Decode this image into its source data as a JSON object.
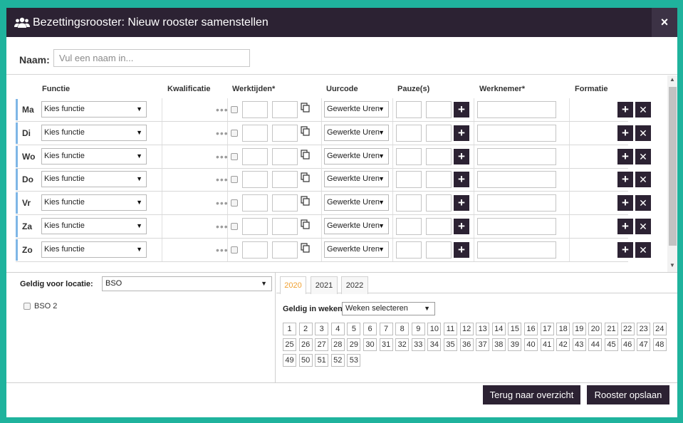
{
  "dialog": {
    "title": "Bezettingsrooster: Nieuw rooster samenstellen",
    "close_label": "×",
    "title_icon": "users-icon"
  },
  "name": {
    "label": "Naam:",
    "placeholder": "Vul een naam in...",
    "value": ""
  },
  "columns": {
    "functie": "Functie",
    "kwalificatie": "Kwalificatie",
    "werktijden": "Werktijden*",
    "uurcode": "Uurcode",
    "pauze": "Pauze(s)",
    "werknemer": "Werknemer*",
    "formatie": "Formatie"
  },
  "rows": [
    {
      "day": "Ma",
      "functie": "Kies functie",
      "uurcode": "Gewerkte Uren"
    },
    {
      "day": "Di",
      "functie": "Kies functie",
      "uurcode": "Gewerkte Uren"
    },
    {
      "day": "Wo",
      "functie": "Kies functie",
      "uurcode": "Gewerkte Uren"
    },
    {
      "day": "Do",
      "functie": "Kies functie",
      "uurcode": "Gewerkte Uren"
    },
    {
      "day": "Vr",
      "functie": "Kies functie",
      "uurcode": "Gewerkte Uren"
    },
    {
      "day": "Za",
      "functie": "Kies functie",
      "uurcode": "Gewerkte Uren"
    },
    {
      "day": "Zo",
      "functie": "Kies functie",
      "uurcode": "Gewerkte Uren"
    }
  ],
  "icons": {
    "dots": "•••",
    "plus": "+",
    "remove": "✕",
    "caret": "▼"
  },
  "location": {
    "label": "Geldig voor locatie:",
    "selected": "BSO",
    "options": [
      "BSO 2"
    ]
  },
  "weeks": {
    "tabs": [
      "2020",
      "2021",
      "2022"
    ],
    "active_tab": "2020",
    "label": "Geldig in weken:",
    "select": "Weken selecteren",
    "numbers": [
      "1",
      "2",
      "3",
      "4",
      "5",
      "6",
      "7",
      "8",
      "9",
      "10",
      "11",
      "12",
      "13",
      "14",
      "15",
      "16",
      "17",
      "18",
      "19",
      "20",
      "21",
      "22",
      "23",
      "24",
      "25",
      "26",
      "27",
      "28",
      "29",
      "30",
      "31",
      "32",
      "33",
      "34",
      "35",
      "36",
      "37",
      "38",
      "39",
      "40",
      "41",
      "42",
      "43",
      "44",
      "45",
      "46",
      "47",
      "48",
      "49",
      "50",
      "51",
      "52",
      "53"
    ]
  },
  "footer": {
    "back_label": "Terug naar overzicht",
    "save_label": "Rooster opslaan"
  },
  "colors": {
    "accent": "#2c2233",
    "frame": "#1fb39d",
    "active_tab": "#f0a030"
  }
}
